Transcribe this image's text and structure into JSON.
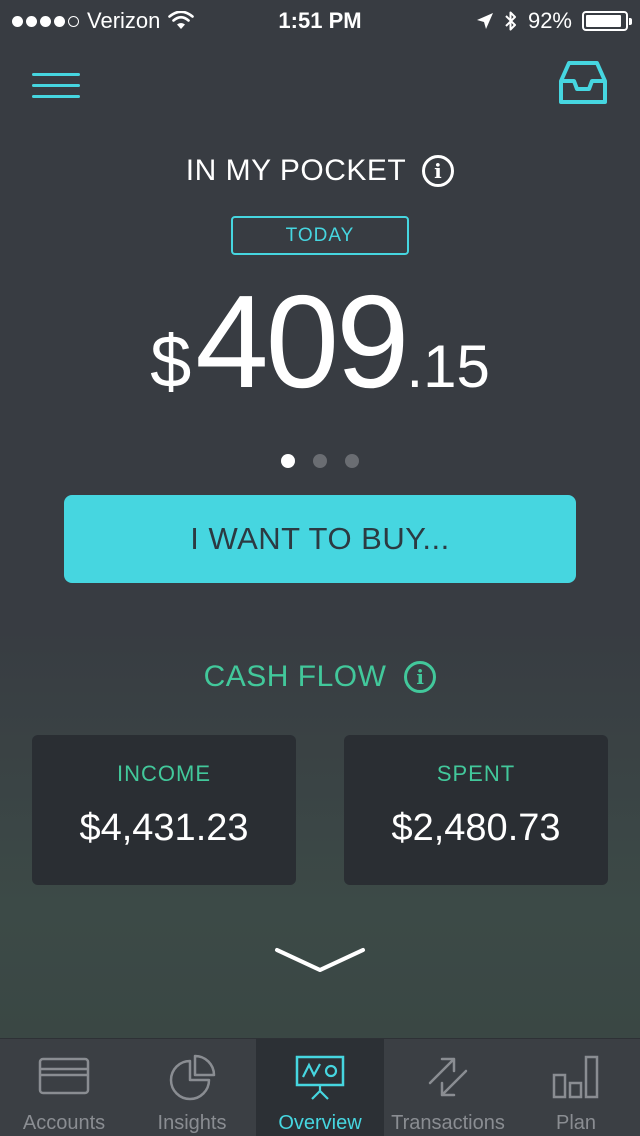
{
  "status_bar": {
    "carrier": "Verizon",
    "time": "1:51 PM",
    "battery": "92%",
    "battery_level": 0.92
  },
  "header": {
    "menu_icon": "hamburger-menu-icon",
    "inbox_icon": "inbox-icon"
  },
  "pocket": {
    "title": "IN MY POCKET",
    "period": "TODAY",
    "currency": "$",
    "amount_whole": "409",
    "amount_cents": ".15",
    "pages": 3,
    "active_page": 0
  },
  "buy_button": {
    "label": "I WANT TO BUY..."
  },
  "cash_flow": {
    "title": "CASH FLOW",
    "income": {
      "label": "INCOME",
      "value": "$4,431.23"
    },
    "spent": {
      "label": "SPENT",
      "value": "$2,480.73"
    }
  },
  "tabs": [
    {
      "label": "Accounts",
      "icon": "credit-card-icon",
      "active": false
    },
    {
      "label": "Insights",
      "icon": "pie-chart-icon",
      "active": false
    },
    {
      "label": "Overview",
      "icon": "presentation-board-icon",
      "active": true
    },
    {
      "label": "Transactions",
      "icon": "swap-arrows-icon",
      "active": false
    },
    {
      "label": "Plan",
      "icon": "bar-chart-icon",
      "active": false
    }
  ],
  "colors": {
    "accent": "#46d6e0",
    "green": "#42c89b",
    "background": "#383c42",
    "card": "#2a2e33"
  }
}
